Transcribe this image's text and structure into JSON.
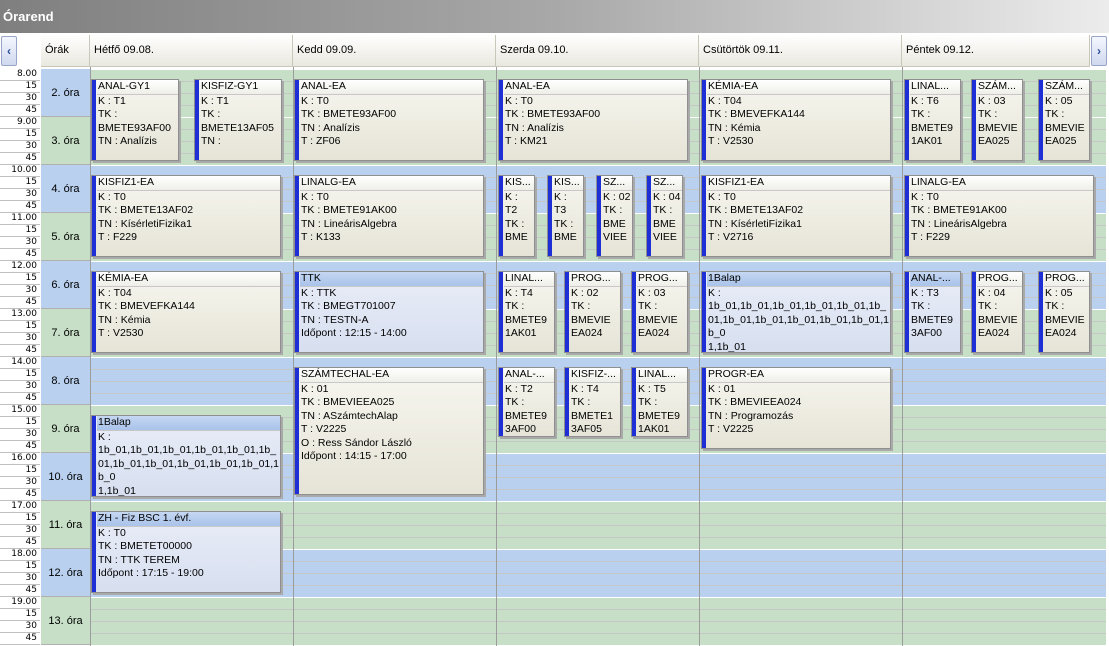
{
  "window": {
    "title": "Órarend"
  },
  "nav": {
    "prev_icon": "‹",
    "next_icon": "›"
  },
  "header": {
    "hours_label": "Órák",
    "days": [
      "Hétfő  09.08.",
      "Kedd  09.09.",
      "Szerda  09.10.",
      "Csütörtök  09.11.",
      "Péntek  09.12."
    ]
  },
  "time_ticks": [
    "8.00",
    "15",
    "30",
    "45",
    "9.00",
    "15",
    "30",
    "45",
    "10.00",
    "15",
    "30",
    "45",
    "11.00",
    "15",
    "30",
    "45",
    "12.00",
    "15",
    "30",
    "45",
    "13.00",
    "15",
    "30",
    "45",
    "14.00",
    "15",
    "30",
    "45",
    "15.00",
    "15",
    "30",
    "45",
    "16.00",
    "15",
    "30",
    "45",
    "17.00",
    "15",
    "30",
    "45",
    "18.00",
    "15",
    "30",
    "45",
    "19.00",
    "15",
    "30",
    "45"
  ],
  "periods": [
    "2. óra",
    "3. óra",
    "4. óra",
    "5. óra",
    "6. óra",
    "7. óra",
    "8. óra",
    "9. óra",
    "10. óra",
    "11. óra",
    "12. óra",
    "13. óra"
  ],
  "colors": {
    "blue_band": "#b9d1ef",
    "green_band": "#c6dfc6",
    "accent_bar": "#1f2fd6"
  },
  "events": [
    {
      "title": "ANAL-GY1",
      "lines": [
        "K : T1",
        "TK :",
        "BMETE93AF00",
        "TN : Analízis"
      ]
    },
    {
      "title": "KISFIZ-GY1",
      "lines": [
        "K : T1",
        "TK :",
        "BMETE13AF05",
        "TN :"
      ]
    },
    {
      "title": "ANAL-EA",
      "lines": [
        "K : T0",
        "TK : BMETE93AF00",
        "TN : Analízis",
        "T : ZF06"
      ]
    },
    {
      "title": "ANAL-EA",
      "lines": [
        "K : T0",
        "TK : BMETE93AF00",
        "TN : Analízis",
        "T : KM21"
      ]
    },
    {
      "title": "KÉMIA-EA",
      "lines": [
        "K : T04",
        "TK : BMEVEFKA144",
        "TN : Kémia",
        "T : V2530"
      ]
    },
    {
      "title": "LINAL...",
      "lines": [
        "K : T6",
        "TK :",
        "BMETE9",
        "1AK01"
      ]
    },
    {
      "title": "SZÁM...",
      "lines": [
        "K : 03",
        "TK :",
        "BMEVIE",
        "EA025"
      ]
    },
    {
      "title": "SZÁM...",
      "lines": [
        "K : 05",
        "TK :",
        "BMEVIE",
        "EA025"
      ]
    },
    {
      "title": "KISFIZ1-EA",
      "lines": [
        "K : T0",
        "TK : BMETE13AF02",
        "TN : KísérletiFizika1",
        "T : F229"
      ]
    },
    {
      "title": "LINALG-EA",
      "lines": [
        "K : T0",
        "TK : BMETE91AK00",
        "TN : LineárisAlgebra",
        "T : K133"
      ]
    },
    {
      "title": "KIS...",
      "lines": [
        "K :",
        "T2",
        "TK :",
        "BME"
      ]
    },
    {
      "title": "KIS...",
      "lines": [
        "K :",
        "T3",
        "TK :",
        "BME"
      ]
    },
    {
      "title": "SZ...",
      "lines": [
        "K : 02",
        "TK :",
        "BME",
        "VIEE"
      ]
    },
    {
      "title": "SZ...",
      "lines": [
        "K : 04",
        "TK :",
        "BME",
        "VIEE"
      ]
    },
    {
      "title": "KISFIZ1-EA",
      "lines": [
        "K : T0",
        "TK : BMETE13AF02",
        "TN : KísérletiFizika1",
        "T : V2716"
      ]
    },
    {
      "title": "LINALG-EA",
      "lines": [
        "K : T0",
        "TK : BMETE91AK00",
        "TN : LineárisAlgebra",
        "T : F229"
      ]
    },
    {
      "title": "KÉMIA-EA",
      "lines": [
        "K : T04",
        "TK : BMEVEFKA144",
        "TN : Kémia",
        "T : V2530"
      ]
    },
    {
      "title": "TTK",
      "lines": [
        "K : TTK",
        "TK : BMEGT701007",
        "TN : TESTN-A",
        "Időpont : 12:15 - 14:00"
      ]
    },
    {
      "title": "LINAL...",
      "lines": [
        "K : T4",
        "TK :",
        "BMETE9",
        "1AK01"
      ]
    },
    {
      "title": "PROG...",
      "lines": [
        "K : 02",
        "TK :",
        "BMEVIE",
        "EA024"
      ]
    },
    {
      "title": "PROG...",
      "lines": [
        "K : 03",
        "TK :",
        "BMEVIE",
        "EA024"
      ]
    },
    {
      "title": "1Balap",
      "lines": [
        "K :",
        "1b_01,1b_01,1b_01,1b_01,1b_01,1b_01,1b_01,1b_01,1b_01,1b_01,1b_01,1b_0",
        "1,1b_01"
      ]
    },
    {
      "title": "ANAL-...",
      "lines": [
        "K : T3",
        "TK :",
        "BMETE9",
        "3AF00"
      ]
    },
    {
      "title": "PROG...",
      "lines": [
        "K : 04",
        "TK :",
        "BMEVIE",
        "EA024"
      ]
    },
    {
      "title": "PROG...",
      "lines": [
        "K : 05",
        "TK :",
        "BMEVIE",
        "EA024"
      ]
    },
    {
      "title": "SZÁMTECHAL-EA",
      "lines": [
        "K : 01",
        "TK : BMEVIEEA025",
        "TN : ASzámtechAlap",
        "T : V2225",
        "O : Ress Sándor László",
        "Időpont : 14:15 - 17:00"
      ]
    },
    {
      "title": "ANAL-...",
      "lines": [
        "K : T2",
        "TK :",
        "BMETE9",
        "3AF00"
      ]
    },
    {
      "title": "KISFIZ-...",
      "lines": [
        "K : T4",
        "TK :",
        "BMETE1",
        "3AF05"
      ]
    },
    {
      "title": "LINAL...",
      "lines": [
        "K : T5",
        "TK :",
        "BMETE9",
        "1AK01"
      ]
    },
    {
      "title": "PROGR-EA",
      "lines": [
        "K : 01",
        "TK : BMEVIEEA024",
        "TN : Programozás",
        "T : V2225"
      ]
    },
    {
      "title": "1Balap",
      "lines": [
        "K :",
        "1b_01,1b_01,1b_01,1b_01,1b_01,1b_01,1b_01,1b_01,1b_01,1b_01,1b_01,1b_0",
        "1,1b_01"
      ]
    },
    {
      "title": "ZH - Fiz BSC 1. évf.",
      "lines": [
        "K : T0",
        "TK : BMETET00000",
        "TN : TTK TEREM",
        "Időpont : 17:15 - 19:00"
      ]
    }
  ]
}
